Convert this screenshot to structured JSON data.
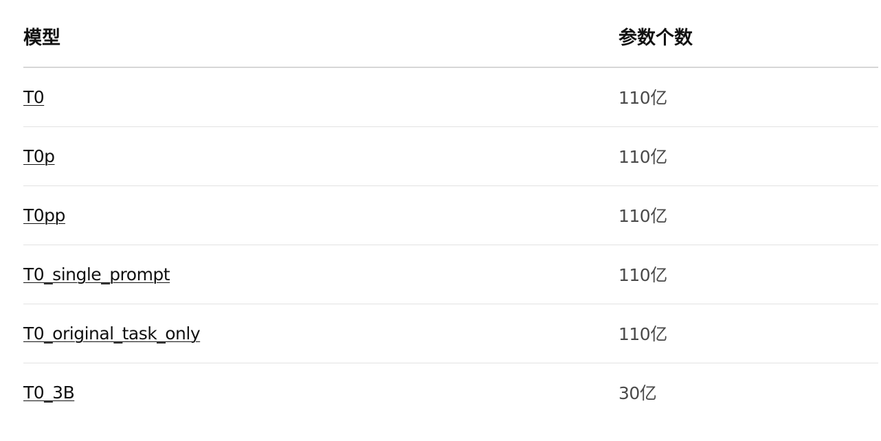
{
  "table": {
    "headers": {
      "model": "模型",
      "params": "参数个数"
    },
    "rows": [
      {
        "model": "T0",
        "params": "110亿"
      },
      {
        "model": "T0p",
        "params": "110亿"
      },
      {
        "model": "T0pp",
        "params": "110亿"
      },
      {
        "model": "T0_single_prompt",
        "params": "110亿"
      },
      {
        "model": "T0_original_task_only",
        "params": "110亿"
      },
      {
        "model": "T0_3B",
        "params": "30亿"
      }
    ]
  },
  "colors": {
    "text": "#111111",
    "muted_text": "#4a4a4a",
    "header_rule": "#d6d6d6",
    "row_rule": "#e2e2e2",
    "background": "#ffffff"
  }
}
